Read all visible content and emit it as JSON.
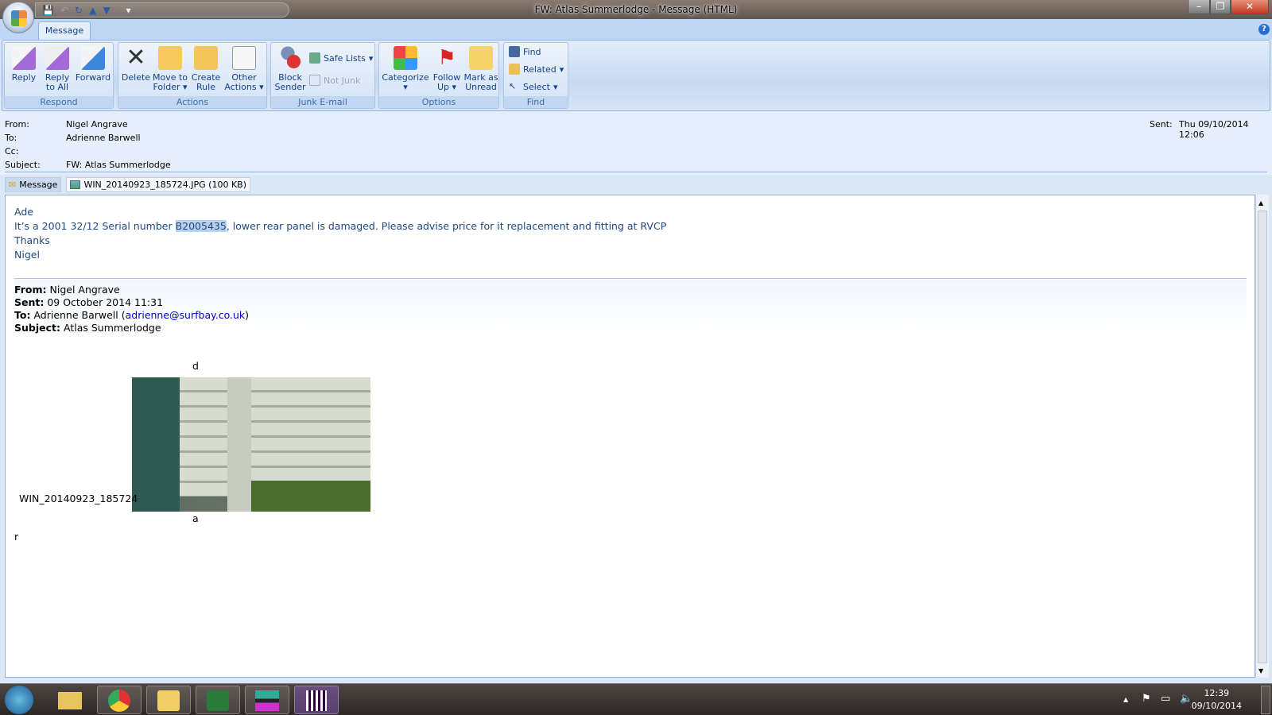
{
  "window": {
    "title": "FW: Atlas Summerlodge - Message (HTML)",
    "minimize": "–",
    "restore": "❐",
    "close": "✕"
  },
  "qat": {
    "save": "💾",
    "undo": "↶",
    "redo": "↻",
    "prev": "▲",
    "next": "▼",
    "customize": "▾"
  },
  "tabs": {
    "message": "Message",
    "help": "?"
  },
  "ribbon": {
    "respond": {
      "label": "Respond",
      "reply": "Reply",
      "reply_all": "Reply to All",
      "forward": "Forward"
    },
    "actions": {
      "label": "Actions",
      "delete": "Delete",
      "move": "Move to Folder",
      "create_rule": "Create Rule",
      "other": "Other Actions"
    },
    "junk": {
      "label": "Junk E-mail",
      "block": "Block Sender",
      "safe_lists": "Safe Lists",
      "not_junk": "Not Junk"
    },
    "options": {
      "label": "Options",
      "categorize": "Categorize",
      "follow_up": "Follow Up",
      "mark_unread": "Mark as Unread"
    },
    "find": {
      "label": "Find",
      "find": "Find",
      "related": "Related",
      "select": "Select"
    }
  },
  "header": {
    "from_label": "From:",
    "from": "Nigel Angrave",
    "to_label": "To:",
    "to": "Adrienne Barwell",
    "cc_label": "Cc:",
    "cc": "",
    "subject_label": "Subject:",
    "subject": "FW: Atlas Summerlodge",
    "sent_label": "Sent:",
    "sent": "Thu 09/10/2014 12:06"
  },
  "attachments": {
    "message": "Message",
    "file": "WIN_20140923_185724.JPG (100 KB)"
  },
  "body": {
    "greeting": "Ade",
    "line_pre": "It’s a 2001 32/12 Serial number ",
    "serial": "B2005435",
    "line_post": ", lower rear panel is damaged. Please advise price for it replacement and fitting at RVCP",
    "thanks": "Thanks",
    "sign": "Nigel",
    "fwd": {
      "from_label": "From:",
      "from": "Nigel Angrave",
      "sent_label": "Sent:",
      "sent": "09 October 2014 11:31",
      "to_label": "To:",
      "to": "Adrienne Barwell",
      "to_email": "adrienne@surfbay.co.uk",
      "subject_label": "Subject:",
      "subject": "Atlas Summerlodge"
    },
    "img_top": "d",
    "img_name": "WIN_20140923_185724",
    "img_bottom": "a",
    "trailing": "r"
  },
  "taskbar": {
    "time": "12:39",
    "date": "09/10/2014",
    "tray_up": "▲"
  }
}
